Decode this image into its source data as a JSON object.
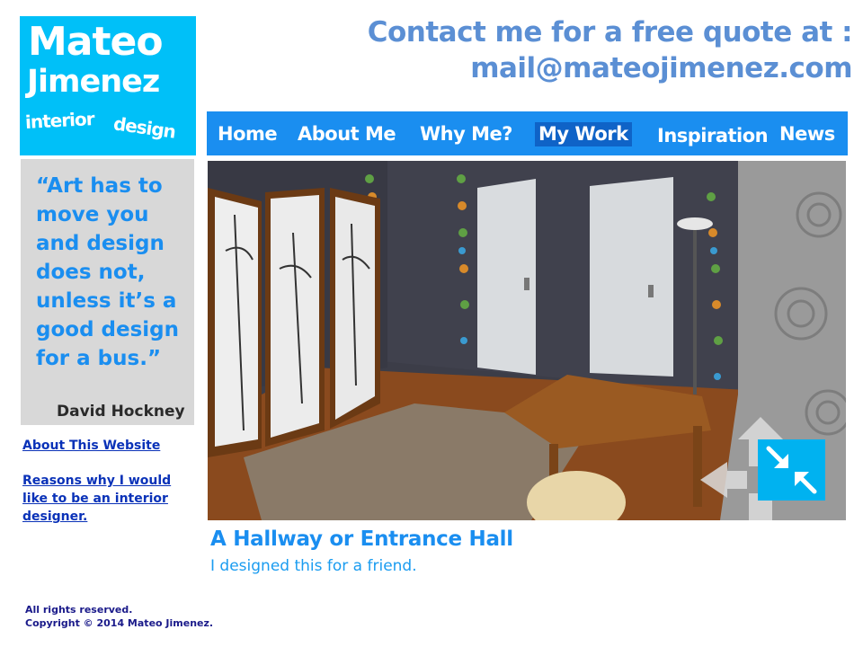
{
  "logo": {
    "first_name": "Mateo",
    "last_name": "Jimenez",
    "tagline_1": "interior",
    "tagline_2": "design"
  },
  "header": {
    "contact_line_1": "Contact me for a free quote at :",
    "contact_line_2": "mail@mateojimenez.com"
  },
  "nav": {
    "items": [
      {
        "label": "Home",
        "active": false
      },
      {
        "label": "About Me",
        "active": false
      },
      {
        "label": "Why Me?",
        "active": false
      },
      {
        "label": "My Work",
        "active": true
      },
      {
        "label": "Inspiration",
        "active": false
      },
      {
        "label": "News",
        "active": false
      }
    ]
  },
  "quote": {
    "text": "“Art has to move you and design does not, unless it’s a good design for a bus.”",
    "author": "David Hockney"
  },
  "sidebar": {
    "link_1": "About This Website",
    "link_2": "Reasons why I would like to be an interior designer."
  },
  "gallery": {
    "shrink_icon": "shrink-arrows-icon",
    "prev_icon": "arrow-left-icon",
    "up_icon": "arrow-up-icon"
  },
  "caption": {
    "title": "A Hallway or Entrance Hall",
    "subtitle": "I designed this for a friend."
  },
  "footer": {
    "line_1": "All rights reserved.",
    "line_2": "Copyright © 2014 Mateo Jimenez."
  },
  "colors": {
    "brand_cyan": "#00c0f8",
    "nav_blue": "#1a8ef0",
    "nav_active": "#0f63c7",
    "contact_blue": "#5b8fd4",
    "link_blue": "#0a32b8"
  }
}
